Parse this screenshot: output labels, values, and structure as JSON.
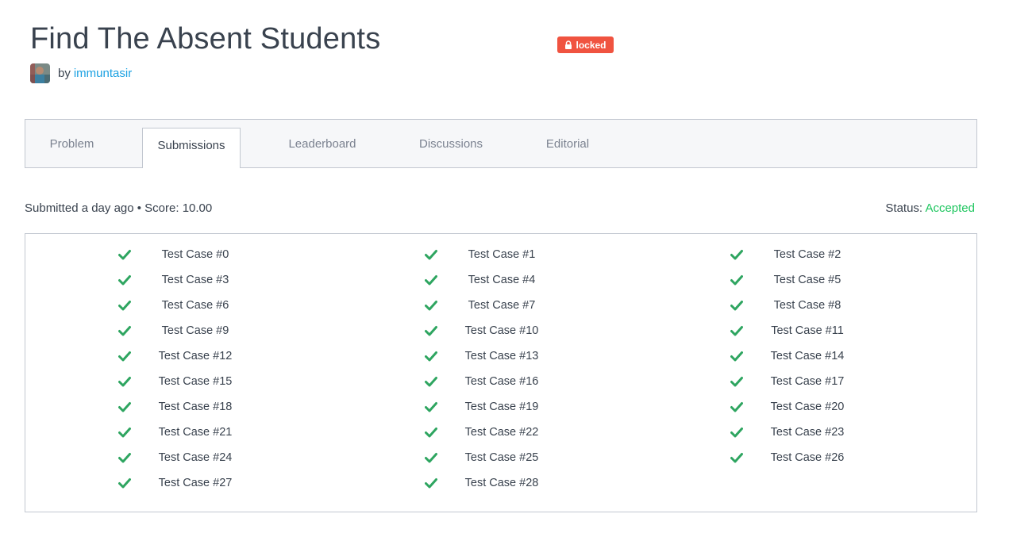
{
  "problem": {
    "title": "Find The Absent Students",
    "badge": "locked",
    "by_label": "by",
    "author": "immuntasir"
  },
  "tabs": [
    "Problem",
    "Submissions",
    "Leaderboard",
    "Discussions",
    "Editorial"
  ],
  "active_tab": "Submissions",
  "submission": {
    "info": "Submitted a day ago • Score: 10.00",
    "status_label": "Status:",
    "status_value": "Accepted"
  },
  "test_cases": [
    "Test Case #0",
    "Test Case #1",
    "Test Case #2",
    "Test Case #3",
    "Test Case #4",
    "Test Case #5",
    "Test Case #6",
    "Test Case #7",
    "Test Case #8",
    "Test Case #9",
    "Test Case #10",
    "Test Case #11",
    "Test Case #12",
    "Test Case #13",
    "Test Case #14",
    "Test Case #15",
    "Test Case #16",
    "Test Case #17",
    "Test Case #18",
    "Test Case #19",
    "Test Case #20",
    "Test Case #21",
    "Test Case #22",
    "Test Case #23",
    "Test Case #24",
    "Test Case #25",
    "Test Case #26",
    "Test Case #27",
    "Test Case #28"
  ],
  "test_case_status": "passed",
  "icons": {
    "badge": "lock-icon",
    "test_case": "check-icon",
    "author": "avatar"
  },
  "colors": {
    "accent": "#1ba1e2",
    "success": "#1ec65f",
    "check": "#2ea560",
    "badge": "#f05340",
    "text": "#39424e"
  }
}
